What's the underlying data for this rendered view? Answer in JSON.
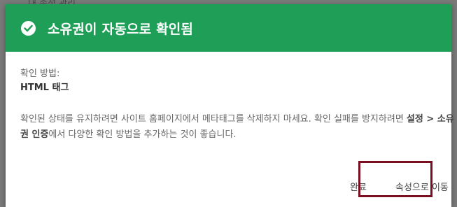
{
  "backdrop": {
    "text": "내 속성 관리"
  },
  "dialog": {
    "title": "소유권이 자동으로 확인됨",
    "method_label": "확인 방법:",
    "method_value": "HTML 태그",
    "info_part1": "확인된 상태를 유지하려면 사이트 홈페이지에서 메타태그를 삭제하지 마세요. 확인 실패를 방지하려면 ",
    "info_bold1": "설정",
    "info_sep": " > ",
    "info_bold2": "소유권 인증",
    "info_part2": "에서 다양한 확인 방법을 추가하는 것이 좋습니다.",
    "done_label": "완료",
    "go_label": "속성으로 이동"
  },
  "colors": {
    "header": "#1e9e57",
    "highlight": "#7a0f22"
  },
  "icons": {
    "header_icon": "check-circle-icon"
  }
}
